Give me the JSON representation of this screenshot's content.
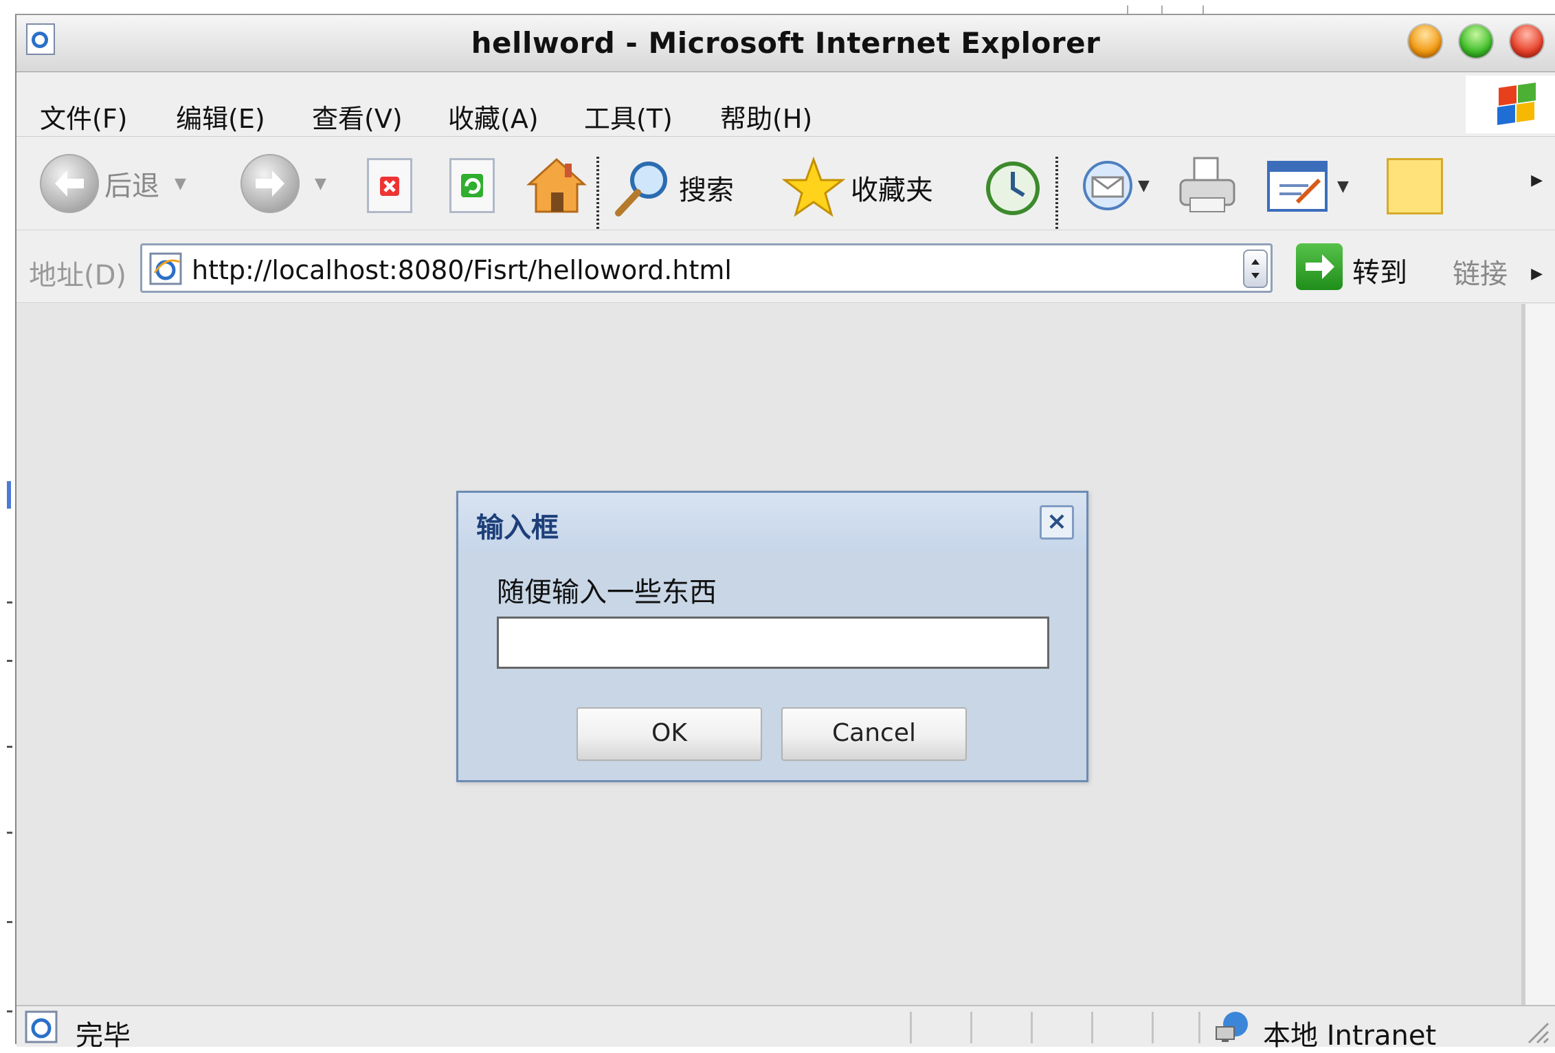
{
  "window": {
    "title": "hellword - Microsoft Internet Explorer"
  },
  "menubar": {
    "items": [
      "文件(F)",
      "编辑(E)",
      "查看(V)",
      "收藏(A)",
      "工具(T)",
      "帮助(H)"
    ]
  },
  "toolbar": {
    "back_label": "后退",
    "search_label": "搜索",
    "favorites_label": "收藏夹"
  },
  "address": {
    "label": "地址(D)",
    "url": "http://localhost:8080/Fisrt/helloword.html",
    "go_label": "转到",
    "links_label": "链接"
  },
  "dialog": {
    "title": "输入框",
    "message": "随便输入一些东西",
    "input_value": "",
    "ok_label": "OK",
    "cancel_label": "Cancel"
  },
  "status": {
    "text": "完毕",
    "zone": "本地 Intranet"
  },
  "colors": {
    "dialog_bg": "#c8d6e6",
    "dialog_title": "#1d3f7a",
    "content_bg": "#e6e6e6"
  }
}
